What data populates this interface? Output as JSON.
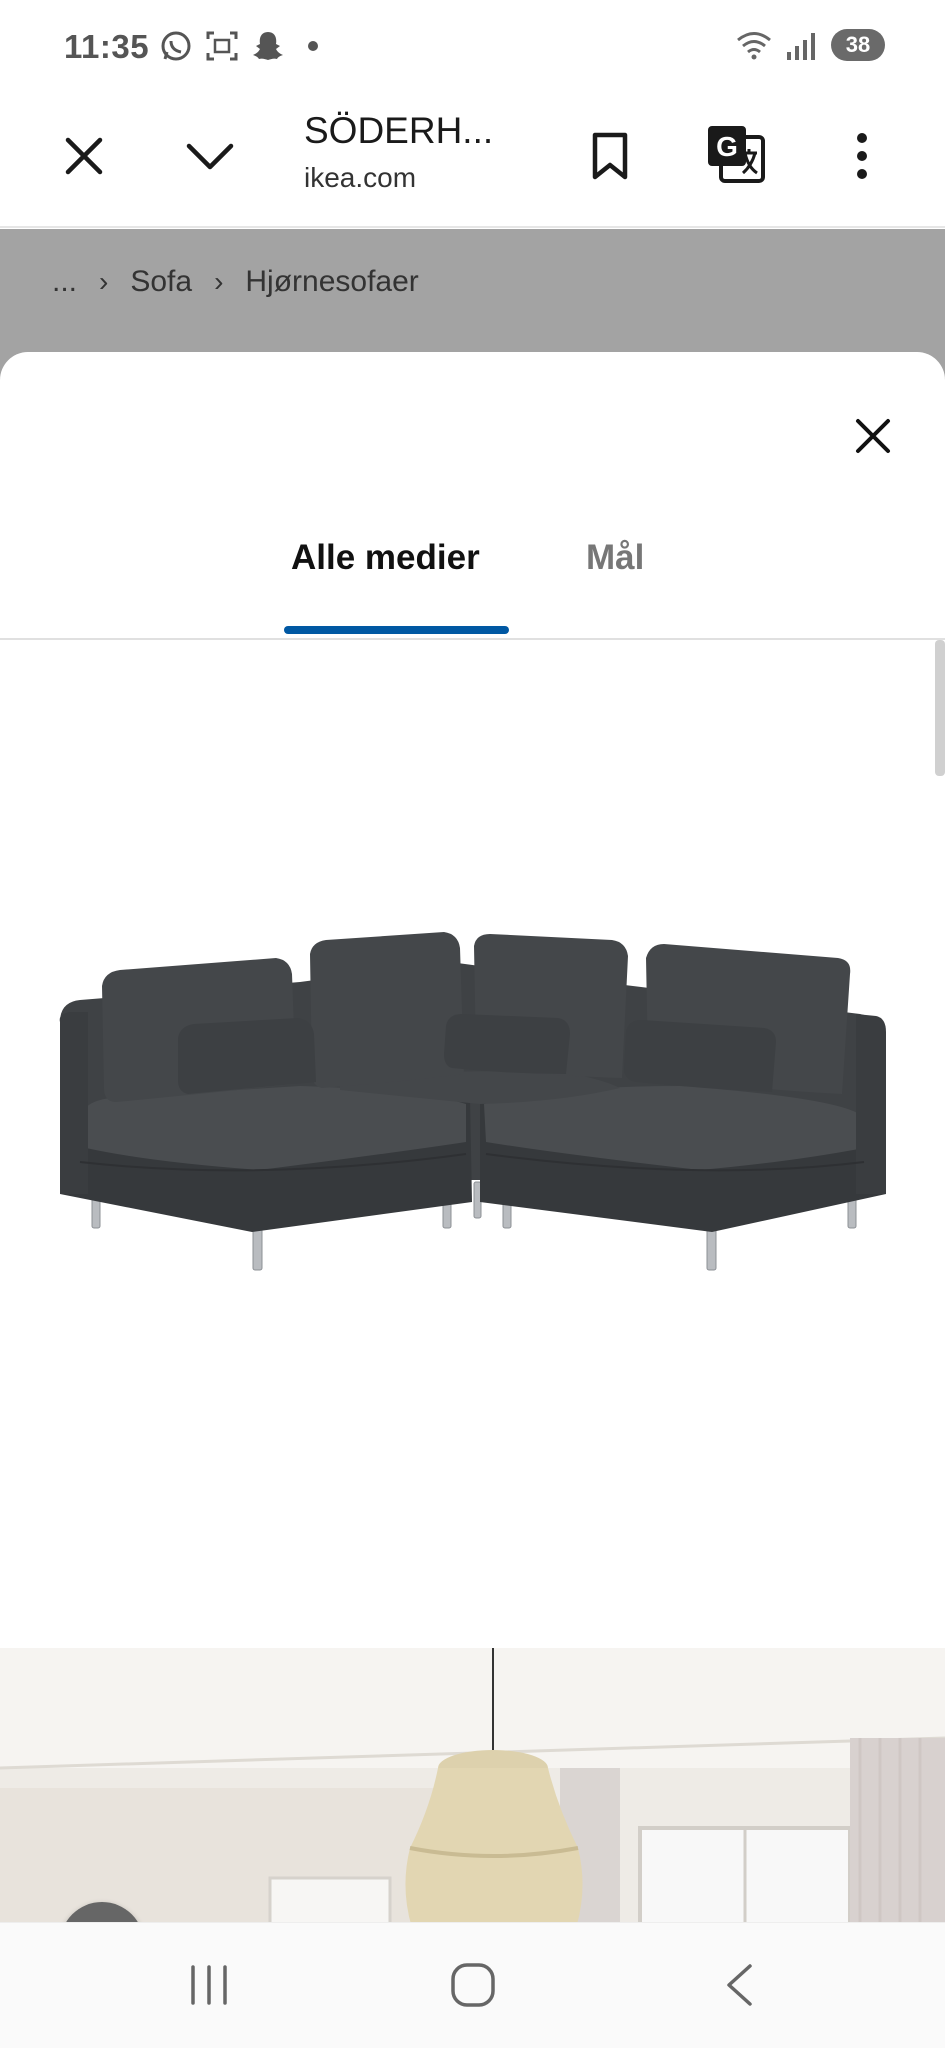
{
  "status_bar": {
    "time": "11:35",
    "battery": "38",
    "left_icons": [
      "whatsapp-icon",
      "screenshot-icon",
      "snapchat-icon"
    ],
    "right_icons": [
      "wifi-icon",
      "signal-icon"
    ]
  },
  "toolbar": {
    "title": "SÖDERH...",
    "url": "ikea.com",
    "icons": [
      "close-icon",
      "chevron-down-icon",
      "bookmark-icon",
      "translate-icon",
      "more-vert-icon"
    ]
  },
  "breadcrumb": {
    "ellipsis": "...",
    "items": [
      "Sofa",
      "Hjørnesofaer"
    ],
    "separator": "›"
  },
  "media_sheet": {
    "tabs": [
      {
        "label": "Alle medier",
        "active": true
      },
      {
        "label": "Mål",
        "active": false
      }
    ],
    "accent_color": "#0058a3",
    "images": [
      "corner-sofa-product-photo",
      "living-room-photo"
    ]
  },
  "nav_bar": {
    "buttons": [
      "recent-apps",
      "home",
      "back"
    ]
  }
}
